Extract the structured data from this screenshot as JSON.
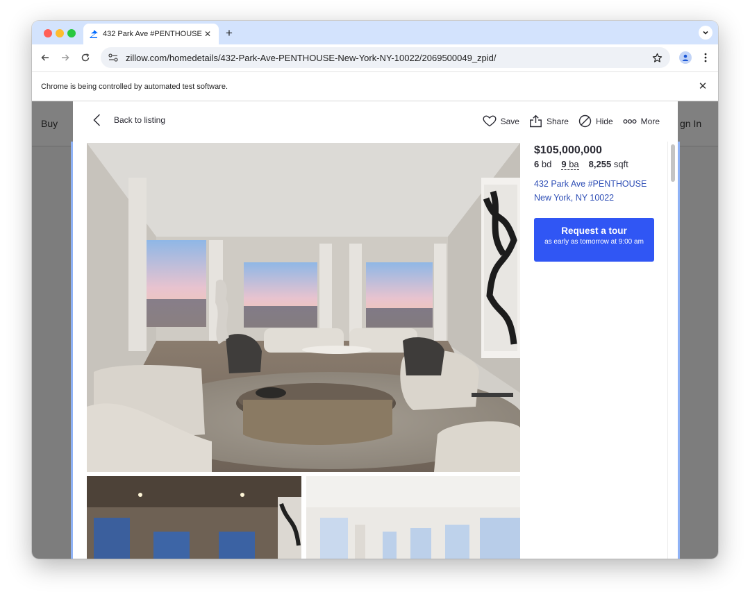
{
  "browser": {
    "tab_title": "432 Park Ave #PENTHOUSE,",
    "url": "zillow.com/homedetails/432-Park-Ave-PENTHOUSE-New-York-NY-10022/2069500049_zpid/",
    "infobar_text": "Chrome is being controlled by automated test software."
  },
  "background_page": {
    "nav_buy": "Buy",
    "nav_signin": "gn In"
  },
  "lightbox": {
    "back_label": "Back to listing",
    "actions": {
      "save": "Save",
      "share": "Share",
      "hide": "Hide",
      "more": "More"
    }
  },
  "listing": {
    "price": "$105,000,000",
    "beds_value": "6",
    "beds_unit": "bd",
    "baths_value": "9",
    "baths_unit": "ba",
    "sqft_value": "8,255",
    "sqft_unit": "sqft",
    "address_line1": "432 Park Ave #PENTHOUSE",
    "address_line2": "New York, NY 10022"
  },
  "tour_button": {
    "title": "Request a tour",
    "subtitle": "as early as tomorrow at 9:00 am"
  },
  "colors": {
    "accent": "#3056f4",
    "link": "#2f4fb6",
    "chrome_tabstrip": "#d3e3fd"
  }
}
